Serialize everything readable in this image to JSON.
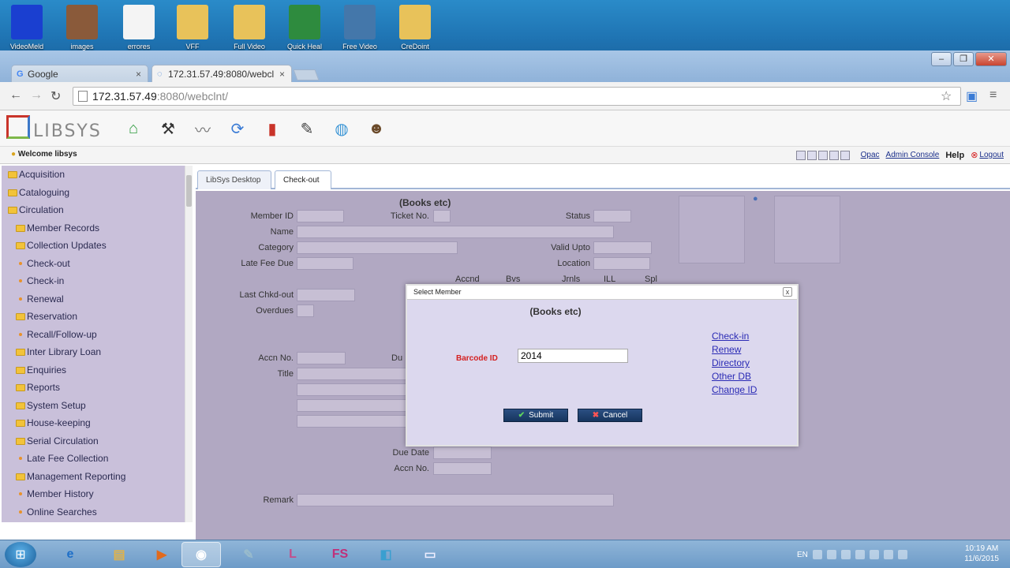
{
  "desktop": {
    "icons": [
      {
        "label": "VideoMeld",
        "color": "#1a3fd0"
      },
      {
        "label": "images",
        "color": "#8a5a3a"
      },
      {
        "label": "errores",
        "color": "#f4f4f4"
      },
      {
        "label": "VFF",
        "color": "#e8c25a"
      },
      {
        "label": "Full Video",
        "color": "#e8c25a"
      },
      {
        "label": "Quick Heal",
        "color": "#2e8b3e"
      },
      {
        "label": "Free Video",
        "color": "#4477aa"
      },
      {
        "label": "CreDoint",
        "color": "#e8c25a"
      }
    ]
  },
  "browser": {
    "tabs": [
      {
        "label": "Google",
        "icon": "google-favicon"
      },
      {
        "label": "172.31.57.49:8080/webcl",
        "icon": "loading-icon"
      }
    ],
    "close_glyph": "×",
    "url_host": "172.31.57.49",
    "url_rest": ":8080/webclnt/",
    "window_controls": {
      "minimize": "–",
      "restore": "❐",
      "close": "✕"
    }
  },
  "app": {
    "logo_text": "LIBSYS",
    "header_icons": [
      "home-icon",
      "checkout-handshake-icon",
      "pen-tool-icon",
      "renew-arrows-icon",
      "books-icon",
      "edit-pencil-icon",
      "globe-icon",
      "user-icon"
    ],
    "welcome": "Welcome libsys",
    "links": {
      "opac": "Opac",
      "admin": "Admin Console",
      "help": "Help",
      "logout": "Logout"
    },
    "sidebar": [
      {
        "label": "Acquisition",
        "type": "folder",
        "indent": 0
      },
      {
        "label": "Cataloguing",
        "type": "folder",
        "indent": 0
      },
      {
        "label": "Circulation",
        "type": "folder",
        "indent": 0
      },
      {
        "label": "Member Records",
        "type": "folder",
        "indent": 1
      },
      {
        "label": "Collection Updates",
        "type": "folder",
        "indent": 1
      },
      {
        "label": "Check-out",
        "type": "item",
        "indent": 1
      },
      {
        "label": "Check-in",
        "type": "item",
        "indent": 1
      },
      {
        "label": "Renewal",
        "type": "item",
        "indent": 1
      },
      {
        "label": "Reservation",
        "type": "folder",
        "indent": 1
      },
      {
        "label": "Recall/Follow-up",
        "type": "item",
        "indent": 1
      },
      {
        "label": "Inter Library Loan",
        "type": "folder",
        "indent": 1
      },
      {
        "label": "Enquiries",
        "type": "folder",
        "indent": 1
      },
      {
        "label": "Reports",
        "type": "folder",
        "indent": 1
      },
      {
        "label": "System Setup",
        "type": "folder",
        "indent": 1
      },
      {
        "label": "House-keeping",
        "type": "folder",
        "indent": 1
      },
      {
        "label": "Serial Circulation",
        "type": "folder",
        "indent": 1
      },
      {
        "label": "Late Fee Collection",
        "type": "item",
        "indent": 1
      },
      {
        "label": "Management Reporting",
        "type": "folder",
        "indent": 1
      },
      {
        "label": "Member History",
        "type": "item",
        "indent": 1
      },
      {
        "label": "Online Searches",
        "type": "item",
        "indent": 1
      }
    ],
    "page_tabs": [
      "LibSys Desktop",
      "Check-out"
    ],
    "form": {
      "title": "(Books etc)",
      "member_id": "Member ID",
      "ticket_no": "Ticket No.",
      "status": "Status",
      "name": "Name",
      "category": "Category",
      "valid_upto": "Valid Upto",
      "late_fee_due": "Late Fee Due",
      "location": "Location",
      "cols": [
        "Accnd",
        "Bvs",
        "Jrnls",
        "ILL",
        "Spl"
      ],
      "last_chkd_out": "Last Chkd-out",
      "overdues": "Overdues",
      "accn_no": "Accn No.",
      "due": "Du",
      "title_label": "Title",
      "due_date": "Due Date",
      "accn_no2": "Accn No.",
      "remark": "Remark"
    },
    "modal": {
      "title": "Select Member",
      "close": "x",
      "heading": "(Books etc)",
      "barcode_label": "Barcode ID",
      "barcode_value": "2014",
      "links": [
        "Check-in",
        "Renew",
        "Directory",
        "Other DB",
        "Change ID"
      ],
      "submit": "Submit",
      "cancel": "Cancel"
    }
  },
  "taskbar": {
    "start": "⊞",
    "apps": [
      {
        "name": "ie",
        "glyph": "e"
      },
      {
        "name": "explorer",
        "glyph": "▤"
      },
      {
        "name": "media",
        "glyph": "▶"
      },
      {
        "name": "chrome",
        "glyph": "◉"
      },
      {
        "name": "paint",
        "glyph": "✎"
      },
      {
        "name": "libsys",
        "glyph": "L"
      },
      {
        "name": "fs",
        "glyph": "FS"
      },
      {
        "name": "app8",
        "glyph": "◧"
      },
      {
        "name": "app9",
        "glyph": "▭"
      }
    ],
    "lang": "EN",
    "time": "10:19 AM",
    "date": "11/6/2015"
  }
}
